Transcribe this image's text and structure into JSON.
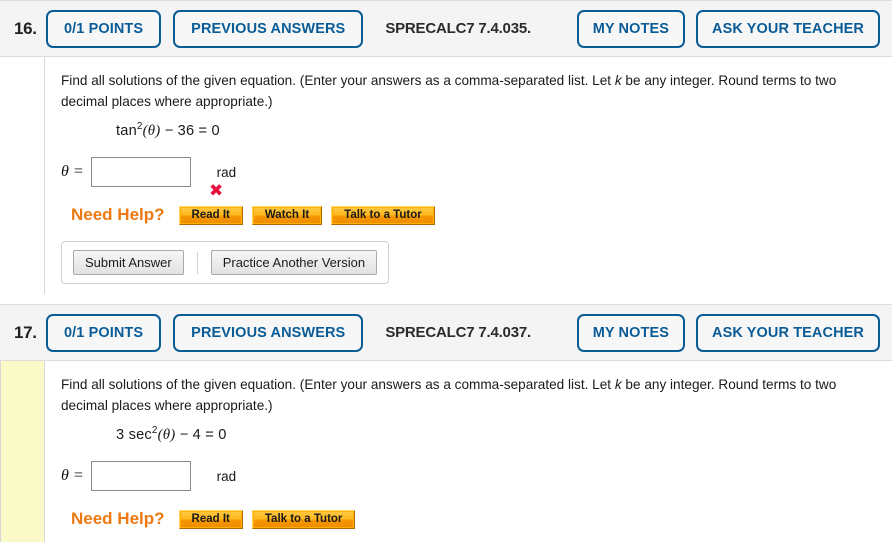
{
  "colors": {
    "accent_blue": "#0a5c96",
    "header_bg": "#f4f4f4",
    "help_orange": "#ef7911",
    "flag_yellow": "#fafac8",
    "wrong_red": "#e8113c"
  },
  "questions": [
    {
      "number": "16.",
      "points_label": "0/1 POINTS",
      "previous_answers_label": "PREVIOUS ANSWERS",
      "code": "SPRECALC7 7.4.035.",
      "my_notes_label": "MY NOTES",
      "ask_teacher_label": "ASK YOUR TEACHER",
      "flagged": false,
      "prompt_part1": "Find all solutions of the given equation. (Enter your answers as a comma-separated list. Let ",
      "prompt_italic": "k",
      "prompt_part2": " be any integer. Round terms to two decimal places where appropriate.)",
      "equation": {
        "fn": "tan",
        "exponent": "2",
        "arg": "(θ)",
        "rest": " − 36 = 0",
        "coefficient": ""
      },
      "answer": {
        "variable": "θ =",
        "value": "",
        "placeholder": "",
        "unit": "rad",
        "mark": "✖",
        "mark_state": "incorrect"
      },
      "need_help_label": "Need Help?",
      "help_buttons": [
        "Read It",
        "Watch It",
        "Talk to a Tutor"
      ],
      "submit_label": "Submit Answer",
      "practice_label": "Practice Another Version",
      "show_submit_strip": true
    },
    {
      "number": "17.",
      "points_label": "0/1 POINTS",
      "previous_answers_label": "PREVIOUS ANSWERS",
      "code": "SPRECALC7 7.4.037.",
      "my_notes_label": "MY NOTES",
      "ask_teacher_label": "ASK YOUR TEACHER",
      "flagged": true,
      "prompt_part1": "Find all solutions of the given equation. (Enter your answers as a comma-separated list. Let ",
      "prompt_italic": "k",
      "prompt_part2": " be any integer. Round terms to two decimal places where appropriate.)",
      "equation": {
        "coefficient": "3 ",
        "fn": "sec",
        "exponent": "2",
        "arg": "(θ)",
        "rest": " − 4 = 0"
      },
      "answer": {
        "variable": "θ =",
        "value": "",
        "placeholder": "",
        "unit": "rad",
        "mark": "",
        "mark_state": "none"
      },
      "need_help_label": "Need Help?",
      "help_buttons": [
        "Read It",
        "Talk to a Tutor"
      ],
      "submit_label": "",
      "practice_label": "",
      "show_submit_strip": false
    }
  ]
}
